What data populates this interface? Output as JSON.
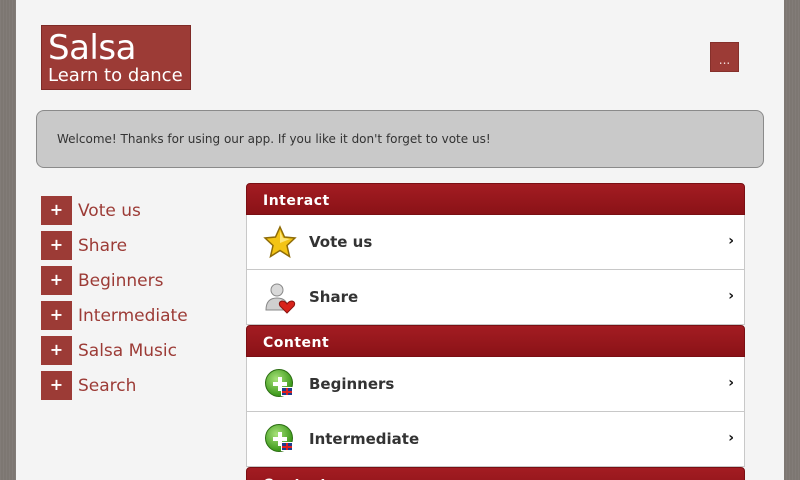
{
  "logo": {
    "title": "Salsa",
    "subtitle": "Learn to dance"
  },
  "header": {
    "menu_label": "..."
  },
  "welcome": {
    "text": "Welcome! Thanks for using our app. If you like it don't forget to vote us!"
  },
  "sidebar": {
    "items": [
      {
        "icon": "+",
        "label": "Vote us"
      },
      {
        "icon": "+",
        "label": "Share"
      },
      {
        "icon": "+",
        "label": "Beginners"
      },
      {
        "icon": "+",
        "label": "Intermediate"
      },
      {
        "icon": "+",
        "label": "Salsa Music"
      },
      {
        "icon": "+",
        "label": "Search"
      }
    ]
  },
  "groups": [
    {
      "title": "Interact",
      "items": [
        {
          "label": "Vote us",
          "icon": "star-icon"
        },
        {
          "label": "Share",
          "icon": "user-heart-icon"
        }
      ]
    },
    {
      "title": "Content",
      "items": [
        {
          "label": "Beginners",
          "icon": "add-english-icon"
        },
        {
          "label": "Intermediate",
          "icon": "add-english-icon"
        }
      ]
    },
    {
      "title": "Contact"
    }
  ],
  "colors": {
    "accent": "#9c3b36",
    "header_red": "#a31c22",
    "page_bg": "#f4f4f4"
  }
}
